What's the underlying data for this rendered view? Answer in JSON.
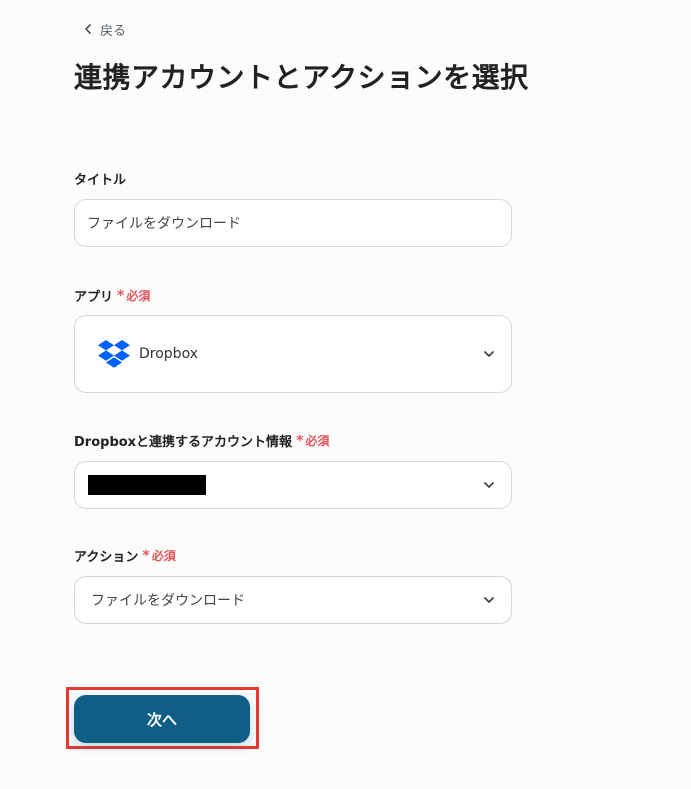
{
  "nav": {
    "back_label": "戻る"
  },
  "page": {
    "title": "連携アカウントとアクションを選択"
  },
  "form": {
    "title_field": {
      "label": "タイトル",
      "value": "ファイルをダウンロード"
    },
    "app_field": {
      "label": "アプリ",
      "required_label": "必須",
      "required_mark": "*",
      "value": "Dropbox",
      "logo_icon": "dropbox-logo"
    },
    "account_field": {
      "label": "Dropboxと連携するアカウント情報",
      "required_label": "必須",
      "required_mark": "*"
    },
    "action_field": {
      "label": "アクション",
      "required_label": "必須",
      "required_mark": "*",
      "value": "ファイルをダウンロード"
    }
  },
  "actions": {
    "next_label": "次へ"
  },
  "colors": {
    "primary": "#0f5e85",
    "required": "#e0555a",
    "dropbox_blue": "#0061fe",
    "highlight": "#e8382f"
  }
}
